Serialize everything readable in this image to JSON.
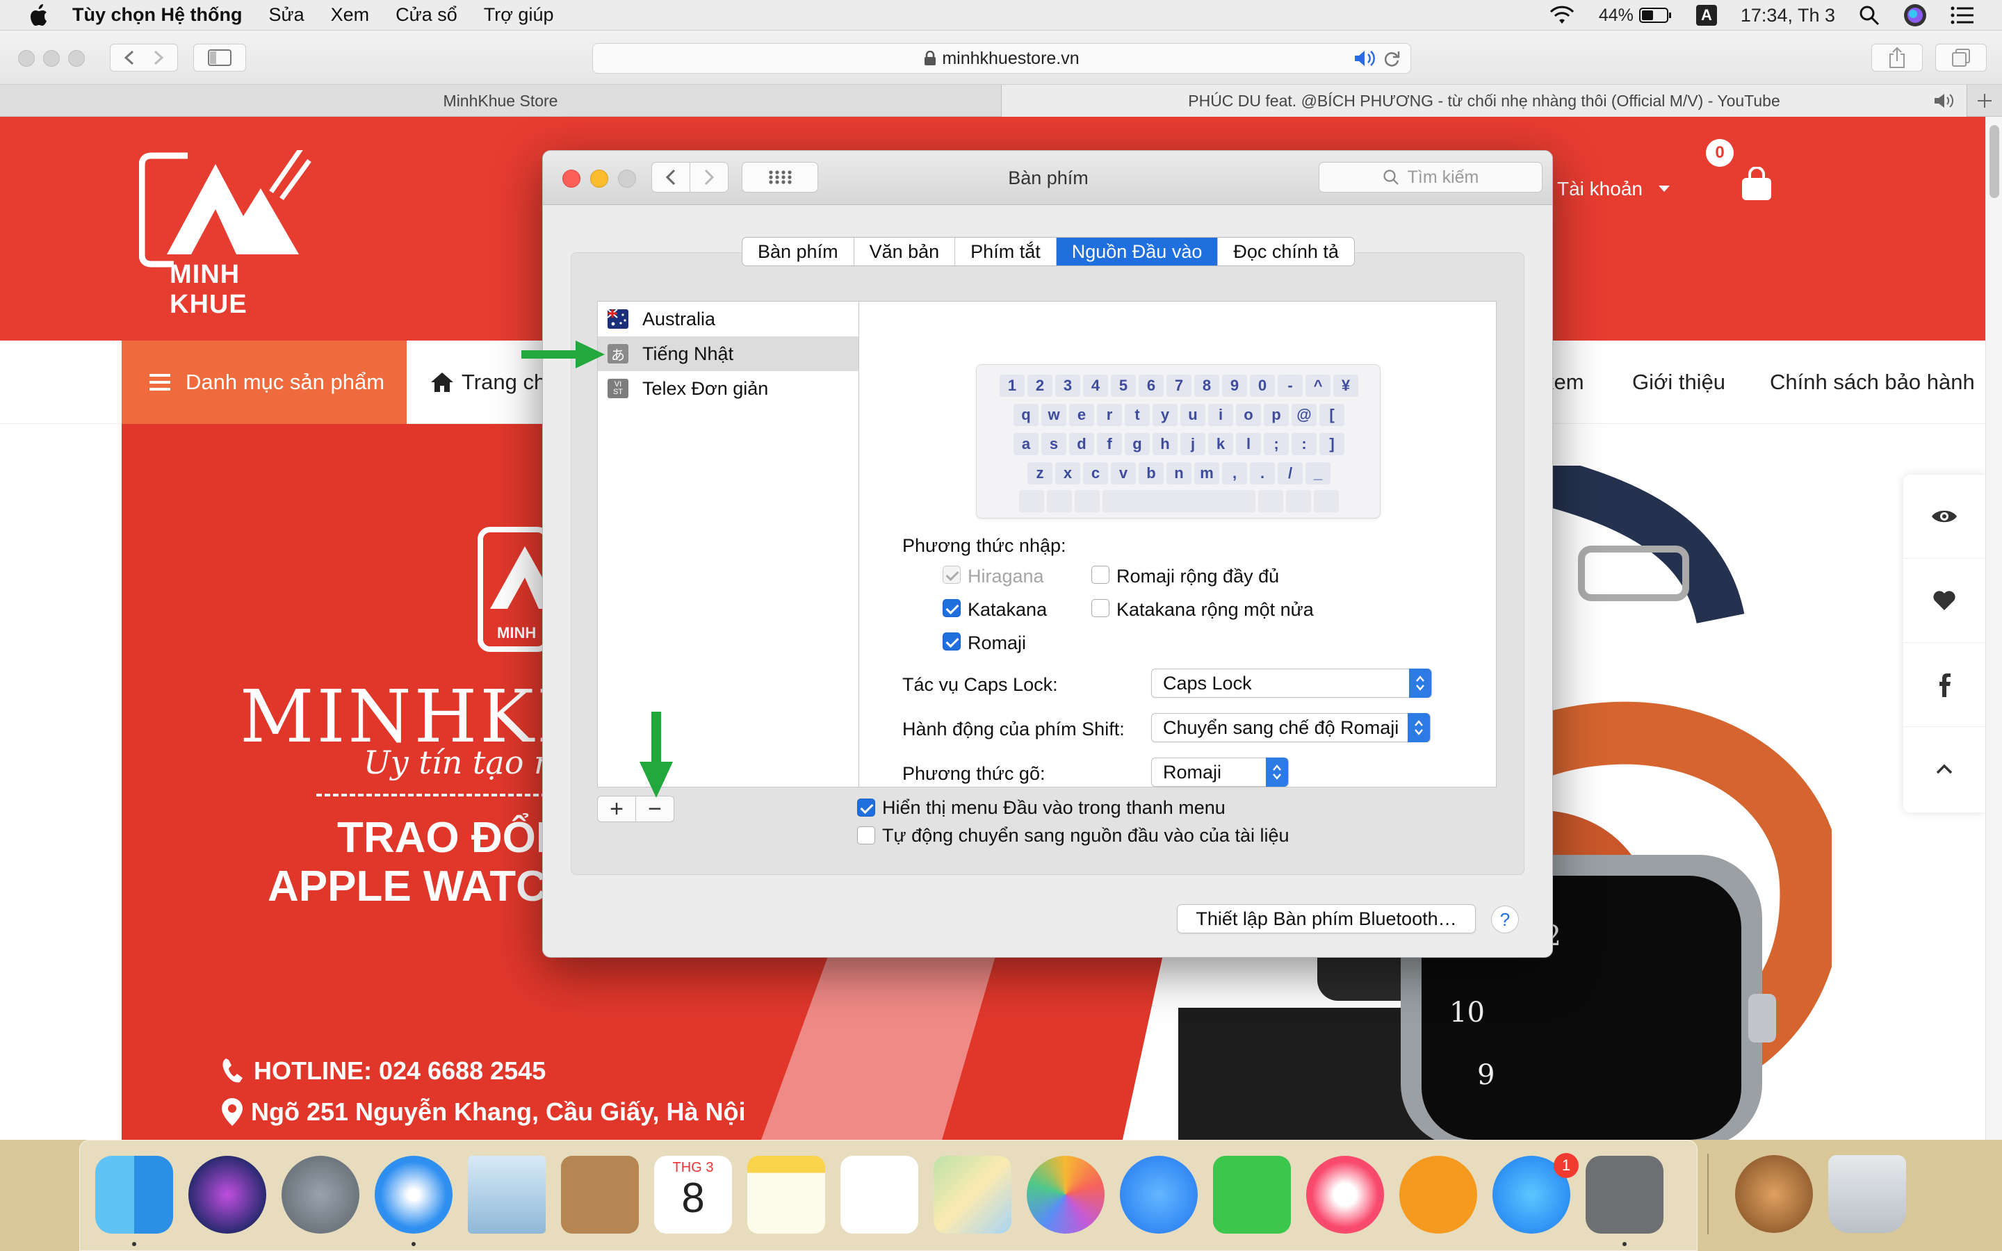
{
  "menubar": {
    "app": "Tùy chọn Hệ thống",
    "items": [
      "Sửa",
      "Xem",
      "Cửa sổ",
      "Trợ giúp"
    ],
    "battery": "44%",
    "input_badge": "A",
    "clock": "17:34, Th 3"
  },
  "browser": {
    "url": "minhkhuestore.vn",
    "tabs": [
      {
        "label": "MinhKhue Store"
      },
      {
        "label": "PHÚC DU feat. @BÍCH PHƯƠNG - từ chối nhẹ nhàng thôi (Official M/V) - YouTube"
      }
    ]
  },
  "site": {
    "logo_text": "MINH KHUE",
    "cart_count": "0",
    "account": "Tài khoản",
    "nav": {
      "category": "Danh mục sản phẩm",
      "home": "Trang ch",
      "partial": "xem",
      "about": "Giới thiệu",
      "policy": "Chính sách bảo hành"
    },
    "banner": {
      "logo_small": "MINH",
      "brand": "MINHKH",
      "slogan": "Uy tín tạo nê",
      "line1": "TRAO ĐỔI",
      "line2": "APPLE WATC",
      "hotline": "HOTLINE: 024 6688 2545",
      "address": "Ngõ 251 Nguyễn Khang, Cầu Giấy, Hà Nội"
    }
  },
  "prefs": {
    "title": "Bàn phím",
    "search_placeholder": "Tìm kiếm",
    "tabs": [
      "Bàn phím",
      "Văn bản",
      "Phím tắt",
      "Nguồn Đầu vào",
      "Đọc chính tả"
    ],
    "active_tab": "Nguồn Đầu vào",
    "sources": [
      {
        "label": "Australia",
        "icon": "flag-australia-icon"
      },
      {
        "label": "Tiếng Nhật",
        "icon": "あ"
      },
      {
        "label": "Telex Đơn giản",
        "icon": "VI ST"
      }
    ],
    "selected_source": "Tiếng Nhật",
    "keyboard_rows": [
      [
        "1",
        "2",
        "3",
        "4",
        "5",
        "6",
        "7",
        "8",
        "9",
        "0",
        "-",
        "^",
        "¥"
      ],
      [
        "q",
        "w",
        "e",
        "r",
        "t",
        "y",
        "u",
        "i",
        "o",
        "p",
        "@",
        "["
      ],
      [
        "a",
        "s",
        "d",
        "f",
        "g",
        "h",
        "j",
        "k",
        "l",
        ";",
        ":",
        "]"
      ],
      [
        "z",
        "x",
        "c",
        "v",
        "b",
        "n",
        "m",
        ",",
        ".",
        "/",
        "_"
      ]
    ],
    "input_methods_label": "Phương thức nhập:",
    "methods": {
      "hiragana": "Hiragana",
      "katakana": "Katakana",
      "romaji": "Romaji",
      "romaji_full": "Romaji rộng đầy đủ",
      "katakana_half": "Katakana rộng một nửa"
    },
    "capslock_label": "Tác vụ Caps Lock:",
    "capslock_value": "Caps Lock",
    "shift_label": "Hành động của phím Shift:",
    "shift_value": "Chuyển sang chế độ Romaji",
    "typing_label": "Phương thức gõ:",
    "typing_value": "Romaji",
    "plus": "+",
    "minus": "−",
    "show_menu": "Hiển thị menu Đầu vào trong thanh menu",
    "auto_switch": "Tự động chuyển sang nguồn đầu vào của tài liệu",
    "bluetooth_button": "Thiết lập Bàn phím Bluetooth…",
    "help": "?"
  },
  "dock": {
    "calendar_month": "THG 3",
    "calendar_day": "8",
    "appstore_badge": "1"
  },
  "colors": {
    "brand_red": "#e73c30",
    "brand_orange": "#ef6b3e",
    "mac_blue": "#1f6fde",
    "annotation_green": "#22a83c"
  }
}
